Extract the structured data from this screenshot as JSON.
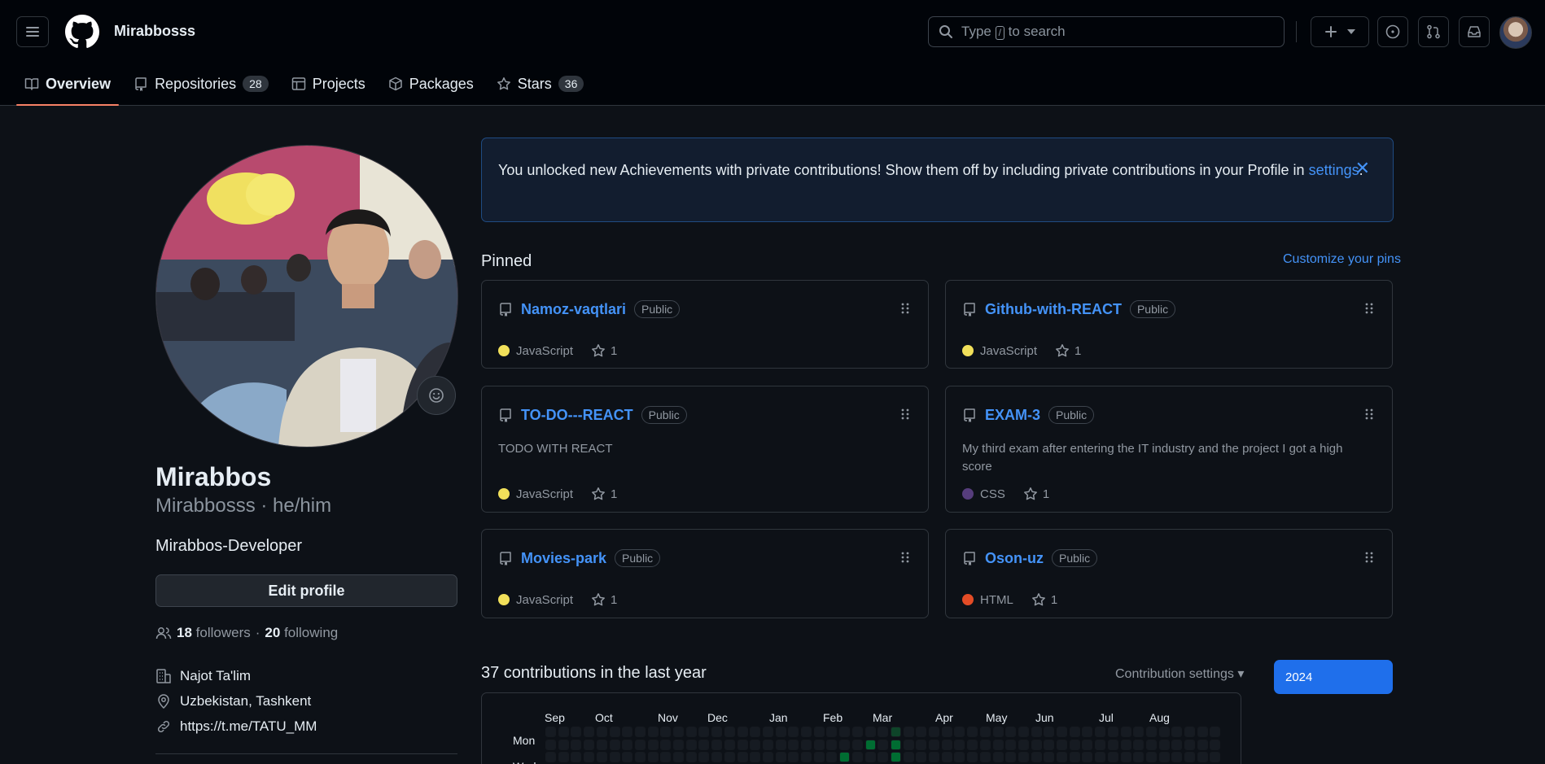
{
  "header": {
    "username": "Mirabbosss",
    "search_placeholder_prefix": "Type",
    "search_slash": "/",
    "search_placeholder_suffix": "to search"
  },
  "tabs": [
    {
      "label": "Overview",
      "icon": "book-icon",
      "count": ""
    },
    {
      "label": "Repositories",
      "icon": "repo-icon",
      "count": "28"
    },
    {
      "label": "Projects",
      "icon": "table-icon",
      "count": ""
    },
    {
      "label": "Packages",
      "icon": "package-icon",
      "count": ""
    },
    {
      "label": "Stars",
      "icon": "star-icon",
      "count": "36"
    }
  ],
  "profile": {
    "name": "Mirabbos",
    "nickname": "Mirabbosss · he/him",
    "bio": "Mirabbos-Developer",
    "edit_label": "Edit profile",
    "followers_count": "18",
    "followers_label": "followers",
    "separator": "·",
    "following_count": "20",
    "following_label": "following",
    "company": "Najot Ta'lim",
    "location": "Uzbekistan, Tashkent",
    "link": "https://t.me/TATU_MM"
  },
  "banner": {
    "text": "You unlocked new Achievements with private contributions! Show them off by including private contributions in your Profile in",
    "link": "settings",
    "end": ".",
    "close": "✕"
  },
  "pinned": {
    "title": "Pinned",
    "customize": "Customize your pins",
    "repos": [
      {
        "name": "Namoz-vaqtlari",
        "visibility": "Public",
        "description": "",
        "language": "JavaScript",
        "color": "#f1e05a",
        "stars": "1"
      },
      {
        "name": "Github-with-REACT",
        "visibility": "Public",
        "description": "",
        "language": "JavaScript",
        "color": "#f1e05a",
        "stars": "1"
      },
      {
        "name": "TO-DO---REACT",
        "visibility": "Public",
        "description": "TODO WITH REACT",
        "language": "JavaScript",
        "color": "#f1e05a",
        "stars": "1"
      },
      {
        "name": "EXAM-3",
        "visibility": "Public",
        "description": "My third exam after entering the IT industry and the project I got a high score",
        "language": "CSS",
        "color": "#563d7c",
        "stars": "1"
      },
      {
        "name": "Movies-park",
        "visibility": "Public",
        "description": "",
        "language": "JavaScript",
        "color": "#f1e05a",
        "stars": "1"
      },
      {
        "name": "Oson-uz",
        "visibility": "Public",
        "description": "",
        "language": "HTML",
        "color": "#e34c26",
        "stars": "1"
      }
    ]
  },
  "contributions": {
    "title": "37 contributions in the last year",
    "settings": "Contribution settings",
    "year": "2024",
    "months": [
      "Sep",
      "Oct",
      "Nov",
      "Dec",
      "Jan",
      "Feb",
      "Mar",
      "Apr",
      "May",
      "Jun",
      "Jul",
      "Aug"
    ],
    "day_labels": [
      "Mon",
      "Wed"
    ],
    "level_colors": [
      "#161b22",
      "#0e4429",
      "#006d32",
      "#26a641",
      "#39d353"
    ],
    "active_cells": [
      {
        "week": 25,
        "row": 1,
        "level": 2
      },
      {
        "week": 27,
        "row": 0,
        "level": 1
      },
      {
        "week": 27,
        "row": 1,
        "level": 2
      },
      {
        "week": 23,
        "row": 2,
        "level": 2
      },
      {
        "week": 23,
        "row": 3,
        "level": 4
      },
      {
        "week": 24,
        "row": 3,
        "level": 2
      },
      {
        "week": 26,
        "row": 3,
        "level": 2
      },
      {
        "week": 27,
        "row": 2,
        "level": 2
      },
      {
        "week": 27,
        "row": 3,
        "level": 3
      },
      {
        "week": 33,
        "row": 3,
        "level": 1
      },
      {
        "week": 45,
        "row": 3,
        "level": 2
      }
    ]
  }
}
